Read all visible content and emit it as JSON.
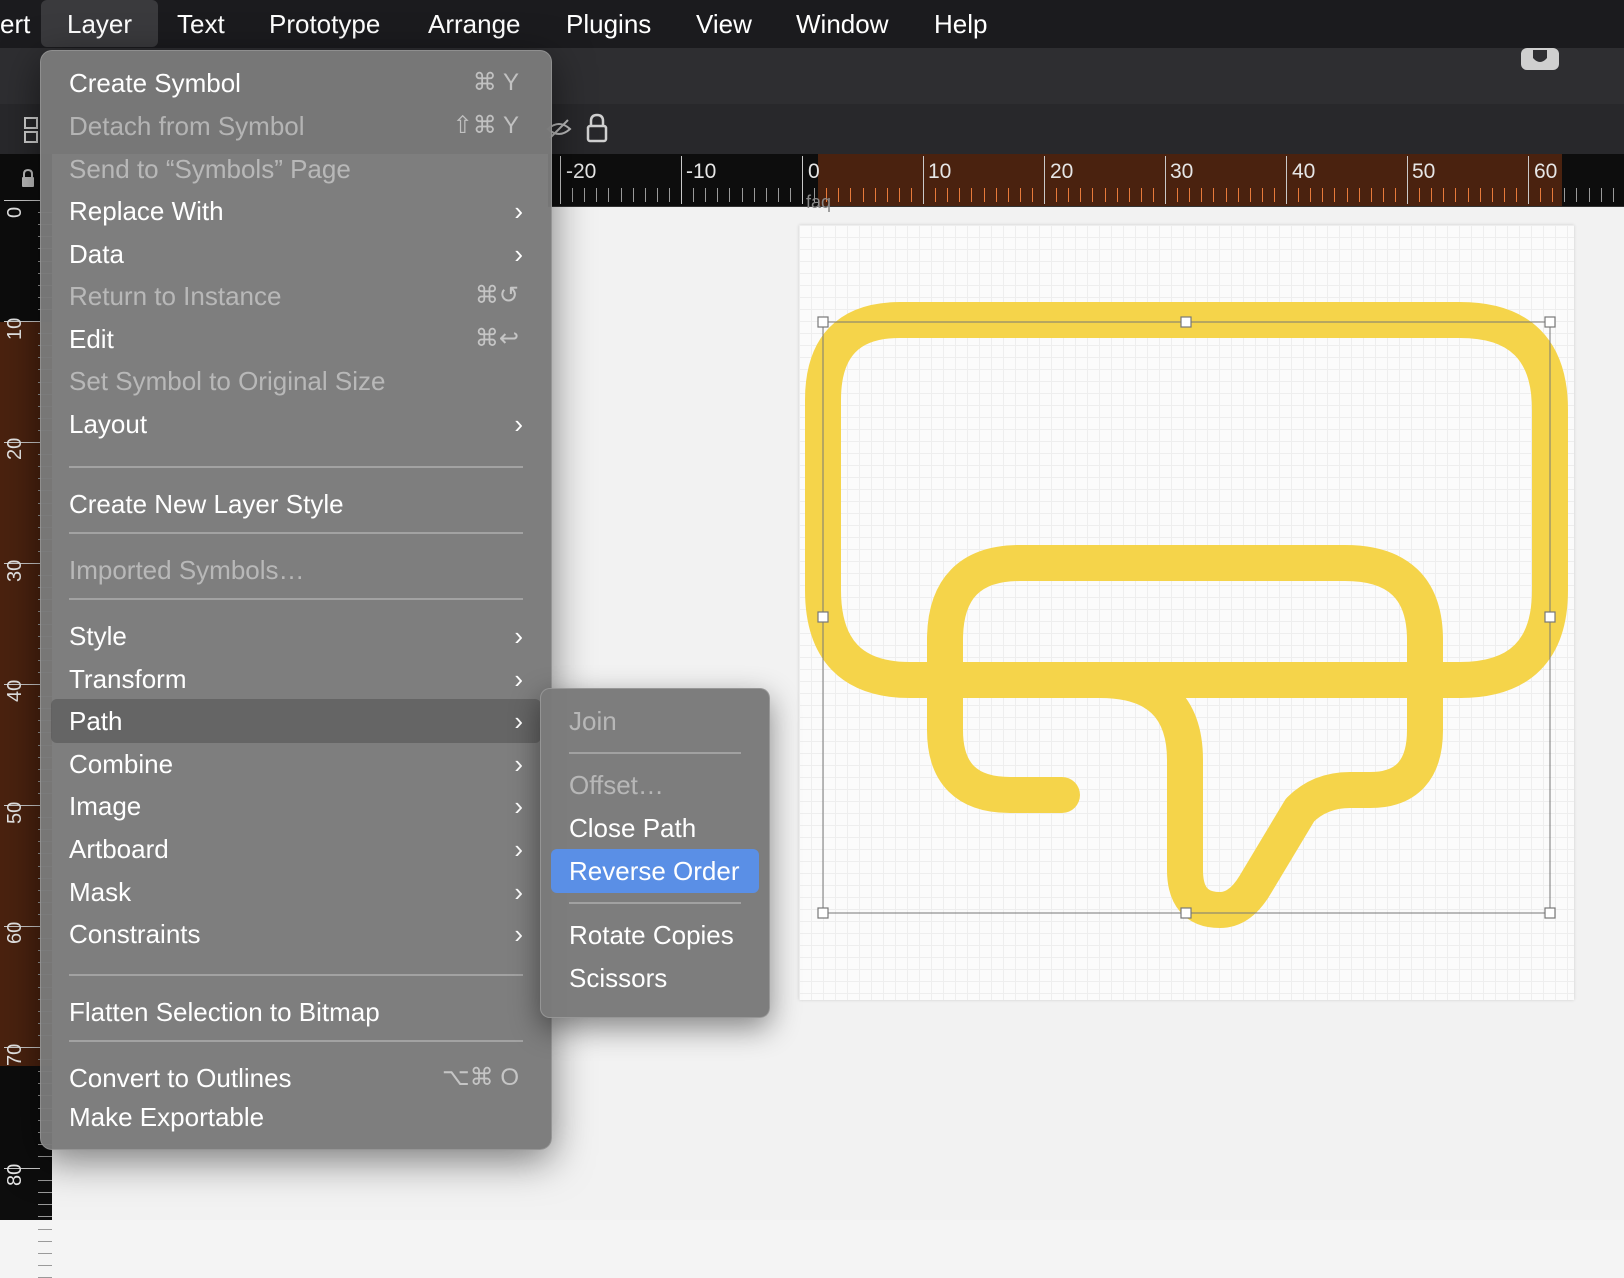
{
  "menubar": {
    "items": [
      "ert",
      "Layer",
      "Text",
      "Prototype",
      "Arrange",
      "Plugins",
      "View",
      "Window",
      "Help"
    ]
  },
  "ruler": {
    "h_labels": [
      "-20",
      "-10",
      "0",
      "10",
      "20",
      "30",
      "40",
      "50",
      "60"
    ],
    "v_labels": [
      "0",
      "10",
      "20",
      "30",
      "40",
      "50",
      "60",
      "70",
      "80"
    ]
  },
  "artboard": {
    "label": "faq"
  },
  "layer_menu": {
    "create_symbol": "Create Symbol",
    "create_symbol_sc": "⌘ Y",
    "detach": "Detach from Symbol",
    "detach_sc": "⇧⌘ Y",
    "send_to": "Send to “Symbols” Page",
    "replace_with": "Replace With",
    "data": "Data",
    "return_instance": "Return to Instance",
    "return_instance_sc": "⌘↺",
    "edit": "Edit",
    "edit_sc": "⌘↩",
    "set_original": "Set Symbol to Original Size",
    "layout": "Layout",
    "create_style": "Create New Layer Style",
    "imported": "Imported Symbols…",
    "style": "Style",
    "transform": "Transform",
    "path": "Path",
    "combine": "Combine",
    "image": "Image",
    "artboard": "Artboard",
    "mask": "Mask",
    "constraints": "Constraints",
    "flatten": "Flatten Selection to Bitmap",
    "outlines": "Convert to Outlines",
    "outlines_sc": "⌥⌘ O",
    "exportable": "Make Exportable",
    "chevron": "›"
  },
  "path_submenu": {
    "join": "Join",
    "offset": "Offset…",
    "close_path": "Close Path",
    "reverse_order": "Reverse Order",
    "rotate_copies": "Rotate Copies",
    "scissors": "Scissors"
  },
  "colors": {
    "shape": "#f5d44a",
    "highlight": "#5a8fe6",
    "ruler_sel": "#4a220f"
  }
}
